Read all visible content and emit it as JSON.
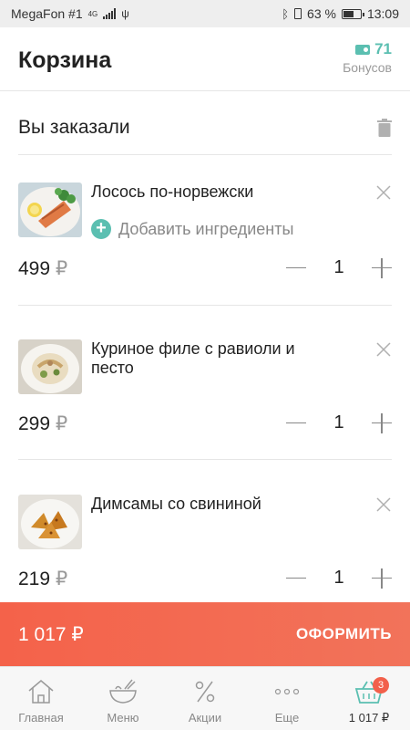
{
  "status_bar": {
    "carrier": "MegaFon #1",
    "network": "4G",
    "battery": "63 %",
    "time": "13:09"
  },
  "header": {
    "title": "Корзина",
    "bonus_value": "71",
    "bonus_label": "Бонусов"
  },
  "section": {
    "title": "Вы заказали"
  },
  "cart": {
    "currency": "₽",
    "add_ingredients_label": "Добавить ингредиенты",
    "items": [
      {
        "name": "Лосось по-норвежски",
        "price": "499",
        "quantity": "1"
      },
      {
        "name": "Куриное филе с равиоли и песто",
        "price": "299",
        "quantity": "1"
      },
      {
        "name": "Димсамы со свининой",
        "price": "219",
        "quantity": "1"
      }
    ]
  },
  "checkout": {
    "total": "1 017 ₽",
    "button_label": "ОФОРМИТЬ"
  },
  "tabbar": {
    "items": [
      {
        "label": "Главная",
        "icon": "home-icon"
      },
      {
        "label": "Меню",
        "icon": "bowl-icon"
      },
      {
        "label": "Акции",
        "icon": "percent-icon"
      },
      {
        "label": "Еще",
        "icon": "more-icon"
      },
      {
        "label": "1 017 ₽",
        "icon": "basket-icon",
        "badge": "3"
      }
    ]
  },
  "colors": {
    "accent": "#5bbfb1",
    "checkout": "#f4624a",
    "badge": "#f2604b"
  }
}
